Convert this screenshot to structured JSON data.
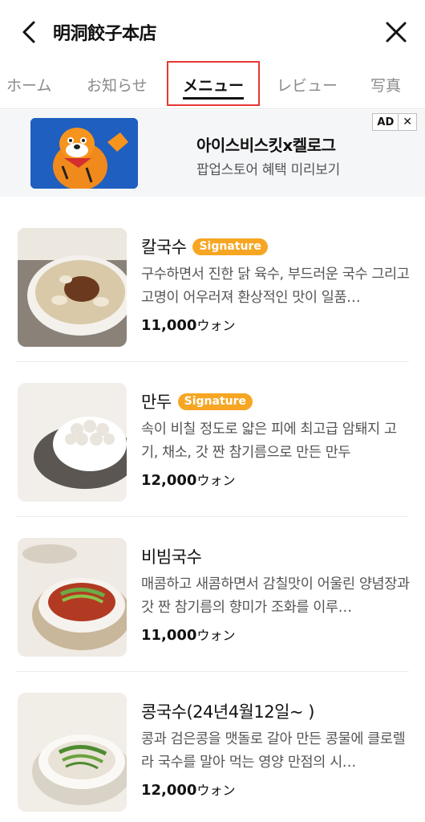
{
  "header": {
    "title": "明洞餃子本店"
  },
  "tabs": [
    {
      "label": "ホーム"
    },
    {
      "label": "お知らせ"
    },
    {
      "label": "メニュー"
    },
    {
      "label": "レビュー"
    },
    {
      "label": "写真"
    }
  ],
  "ad": {
    "title": "아이스비스킷x켈로그",
    "subtitle": "팝업스토어 혜택 미리보기",
    "badge": "AD",
    "close": "✕"
  },
  "menu": {
    "unit": "ウォン",
    "items": [
      {
        "name": "칼국수",
        "badge": "Signature",
        "description": "구수하면서 진한 닭 육수, 부드러운 국수 그리고 고명이 어우러져 환상적인 맛이 일품…",
        "price": "11,000"
      },
      {
        "name": "만두",
        "badge": "Signature",
        "description": "속이 비칠 정도로 얇은 피에 최고급 암퇘지 고기, 채소, 갓 짠 참기름으로 만든 만두",
        "price": "12,000"
      },
      {
        "name": "비빔국수",
        "badge": "",
        "description": "매콤하고 새콤하면서 감칠맛이 어울린 양념장과 갓 짠 참기름의 향미가 조화를 이루…",
        "price": "11,000"
      },
      {
        "name": "콩국수(24년4월12일~ )",
        "badge": "",
        "description": "콩과 검은콩을 맷돌로 갈아 만든 콩물에 클로렐라 국수를 말아 먹는 영양 만점의 시…",
        "price": "12,000"
      }
    ]
  },
  "colors": {
    "accent_badge": "#f6a623",
    "selected_tab_outline": "#e53935"
  }
}
